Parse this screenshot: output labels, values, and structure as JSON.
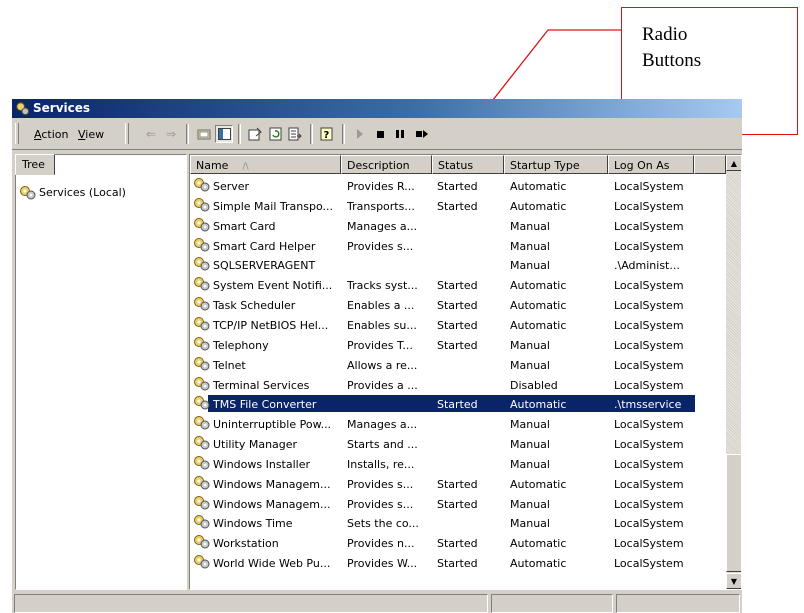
{
  "annotation": {
    "line1": "Radio",
    "line2": "Buttons",
    "color": "#e01010"
  },
  "window": {
    "title": "Services"
  },
  "menu": [
    {
      "label": "Action",
      "accel": "A",
      "rest": "ction"
    },
    {
      "label": "View",
      "accel": "V",
      "rest": "iew"
    }
  ],
  "toolbar_icons": [
    "back-arrow",
    "forward-arrow",
    "up-folder",
    "show-hide-tree",
    "properties",
    "refresh",
    "export-list",
    "help",
    "start-service",
    "stop-service",
    "pause-service",
    "restart-service"
  ],
  "tree": {
    "tab_label": "Tree",
    "root_label": "Services (Local)"
  },
  "columns": [
    "Name",
    "Description",
    "Status",
    "Startup Type",
    "Log On As"
  ],
  "sort_indicator": "/\\",
  "rows": [
    {
      "name": "Server",
      "description": "Provides R...",
      "status": "Started",
      "startup": "Automatic",
      "logon": "LocalSystem"
    },
    {
      "name": "Simple Mail Transpo...",
      "description": "Transports...",
      "status": "Started",
      "startup": "Automatic",
      "logon": "LocalSystem"
    },
    {
      "name": "Smart Card",
      "description": "Manages a...",
      "status": "",
      "startup": "Manual",
      "logon": "LocalSystem"
    },
    {
      "name": "Smart Card Helper",
      "description": "Provides s...",
      "status": "",
      "startup": "Manual",
      "logon": "LocalSystem"
    },
    {
      "name": "SQLSERVERAGENT",
      "description": "",
      "status": "",
      "startup": "Manual",
      "logon": ".\\Administ..."
    },
    {
      "name": "System Event Notifi...",
      "description": "Tracks syst...",
      "status": "Started",
      "startup": "Automatic",
      "logon": "LocalSystem"
    },
    {
      "name": "Task Scheduler",
      "description": "Enables a ...",
      "status": "Started",
      "startup": "Automatic",
      "logon": "LocalSystem"
    },
    {
      "name": "TCP/IP NetBIOS Hel...",
      "description": "Enables su...",
      "status": "Started",
      "startup": "Automatic",
      "logon": "LocalSystem"
    },
    {
      "name": "Telephony",
      "description": "Provides T...",
      "status": "Started",
      "startup": "Manual",
      "logon": "LocalSystem"
    },
    {
      "name": "Telnet",
      "description": "Allows a re...",
      "status": "",
      "startup": "Manual",
      "logon": "LocalSystem"
    },
    {
      "name": "Terminal Services",
      "description": "Provides a ...",
      "status": "",
      "startup": "Disabled",
      "logon": "LocalSystem"
    },
    {
      "name": "TMS File Converter",
      "description": "",
      "status": "Started",
      "startup": "Automatic",
      "logon": ".\\tmsservice",
      "selected": true
    },
    {
      "name": "Uninterruptible Pow...",
      "description": "Manages a...",
      "status": "",
      "startup": "Manual",
      "logon": "LocalSystem"
    },
    {
      "name": "Utility Manager",
      "description": "Starts and ...",
      "status": "",
      "startup": "Manual",
      "logon": "LocalSystem"
    },
    {
      "name": "Windows Installer",
      "description": "Installs, re...",
      "status": "",
      "startup": "Manual",
      "logon": "LocalSystem"
    },
    {
      "name": "Windows Managem...",
      "description": "Provides s...",
      "status": "Started",
      "startup": "Automatic",
      "logon": "LocalSystem"
    },
    {
      "name": "Windows Managem...",
      "description": "Provides s...",
      "status": "Started",
      "startup": "Manual",
      "logon": "LocalSystem"
    },
    {
      "name": "Windows Time",
      "description": "Sets the co...",
      "status": "",
      "startup": "Manual",
      "logon": "LocalSystem"
    },
    {
      "name": "Workstation",
      "description": "Provides n...",
      "status": "Started",
      "startup": "Automatic",
      "logon": "LocalSystem"
    },
    {
      "name": "World Wide Web Pu...",
      "description": "Provides W...",
      "status": "Started",
      "startup": "Automatic",
      "logon": "LocalSystem"
    }
  ],
  "colors": {
    "selection": "#0a246a",
    "titlebar_start": "#0a246a",
    "titlebar_end": "#a6caf0",
    "window_face": "#d4d0c8"
  }
}
